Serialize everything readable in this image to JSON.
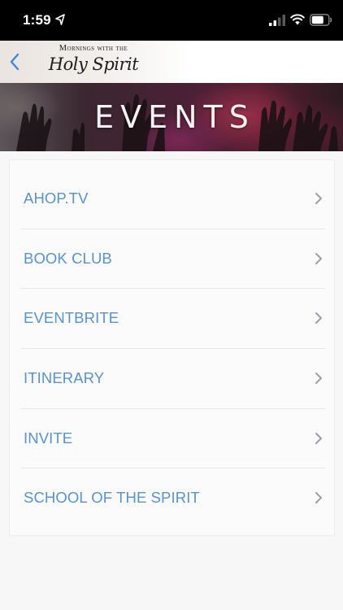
{
  "status_bar": {
    "time": "1:59",
    "icons": [
      "location-arrow-icon",
      "cellular-signal-icon",
      "wifi-icon",
      "battery-icon"
    ]
  },
  "header": {
    "back_icon": "chevron-left-icon",
    "logo_line1": "Mornings with the",
    "logo_line2": "Holy Spirit"
  },
  "banner": {
    "title": "EVENTS"
  },
  "menu": {
    "items": [
      {
        "label": "AHOP.TV",
        "icon": "chevron-right-icon"
      },
      {
        "label": "BOOK CLUB",
        "icon": "chevron-right-icon"
      },
      {
        "label": "EVENTBRITE",
        "icon": "chevron-right-icon"
      },
      {
        "label": "ITINERARY",
        "icon": "chevron-right-icon"
      },
      {
        "label": "INVITE",
        "icon": "chevron-right-icon"
      },
      {
        "label": "SCHOOL OF THE SPIRIT",
        "icon": "chevron-right-icon"
      }
    ]
  },
  "colors": {
    "accent": "#5b93c8",
    "chevron": "#9b9ea6",
    "background": "#f7f7f8"
  }
}
